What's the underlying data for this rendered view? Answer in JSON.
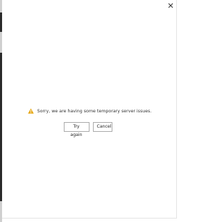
{
  "dialog": {
    "close_icon": "close-icon",
    "message": {
      "icon": "warning-icon",
      "icon_color": "#e6a817",
      "text": "Sorry, we are having some temporary server issues."
    },
    "buttons": {
      "try_again_label": "Try again",
      "cancel_label": "Cancel"
    }
  }
}
